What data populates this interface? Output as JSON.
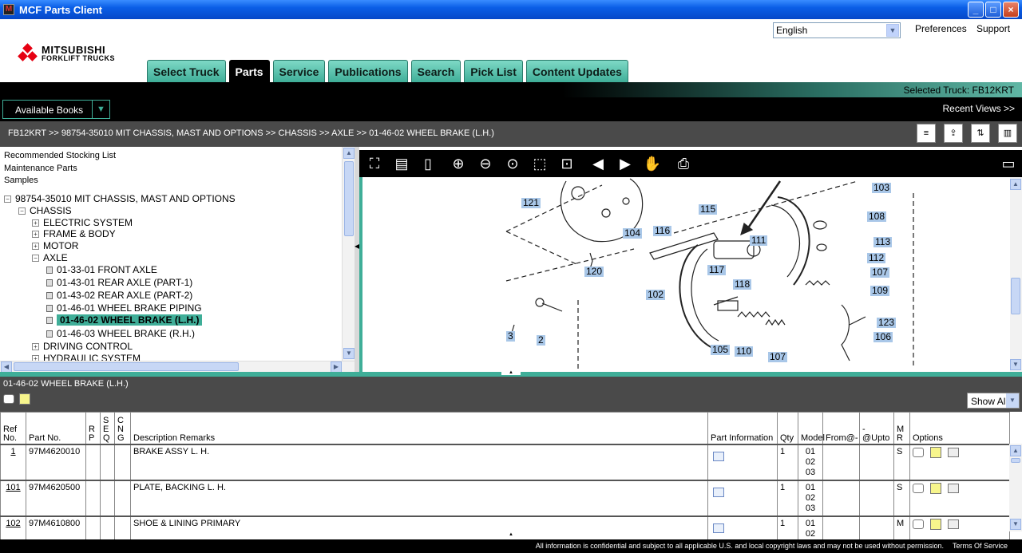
{
  "window": {
    "title": "MCF Parts Client"
  },
  "header": {
    "logo_line1": "MITSUBISHI",
    "logo_line2": "FORKLIFT TRUCKS",
    "language": "English",
    "links": [
      "Preferences",
      "Support"
    ],
    "tabs": [
      "Select Truck",
      "Parts",
      "Service",
      "Publications",
      "Search",
      "Pick List",
      "Content Updates"
    ],
    "active_tab": "Parts"
  },
  "selected_truck": "Selected Truck:  FB12KRT",
  "available_books": "Available Books",
  "recent_views": "Recent Views >>",
  "breadcrumb": "FB12KRT >> 98754-35010 MIT CHASSIS, MAST AND OPTIONS >> CHASSIS >> AXLE >> 01-46-02 WHEEL BRAKE (L.H.)",
  "tree": {
    "top_links": [
      "Recommended Stocking List",
      "Maintenance Parts",
      "Samples"
    ],
    "root": "98754-35010 MIT CHASSIS, MAST AND OPTIONS",
    "chassis": "CHASSIS",
    "groups": [
      "ELECTRIC SYSTEM",
      "FRAME & BODY",
      "MOTOR",
      "AXLE"
    ],
    "axle_items": [
      "01-33-01 FRONT AXLE",
      "01-43-01 REAR AXLE (PART-1)",
      "01-43-02 REAR AXLE (PART-2)",
      "01-46-01 WHEEL BRAKE PIPING",
      "01-46-02 WHEEL BRAKE (L.H.)",
      "01-46-03 WHEEL BRAKE (R.H.)"
    ],
    "more_groups": [
      "DRIVING CONTROL",
      "HYDRAULIC SYSTEM"
    ]
  },
  "diagram_labels": [
    "121",
    "115",
    "116",
    "104",
    "111",
    "103",
    "108",
    "113",
    "112",
    "120",
    "117",
    "118",
    "102",
    "107",
    "109",
    "123",
    "106",
    "3",
    "2",
    "105",
    "110",
    "107"
  ],
  "parts_panel": {
    "title": "01-46-02 WHEEL BRAKE (L.H.)",
    "filter": "Show All",
    "columns": {
      "ref": "Ref No.",
      "part": "Part No.",
      "rp": "R P",
      "seq": "S E Q",
      "cng": "C N G",
      "desc": "Description Remarks",
      "pinfo": "Part Information",
      "qty": "Qty",
      "model": "Model",
      "from": "From@-",
      "upto": "-@Upto",
      "mr": "M R",
      "options": "Options"
    },
    "rows": [
      {
        "ref": "1",
        "part": "97M4620010",
        "desc": "BRAKE ASSY L. H.",
        "qty": "1",
        "models": [
          "01",
          "02",
          "03"
        ],
        "mr": "S"
      },
      {
        "ref": "101",
        "part": "97M4620500",
        "desc": "PLATE, BACKING L. H.",
        "qty": "1",
        "models": [
          "01",
          "02",
          "03"
        ],
        "mr": "S"
      },
      {
        "ref": "102",
        "part": "97M4610800",
        "desc": "SHOE & LINING PRIMARY",
        "qty": "1",
        "models": [
          "01",
          "02"
        ],
        "mr": "M"
      }
    ]
  },
  "footer": {
    "notice": "All information is confidential and subject to all applicable U.S. and local copyright laws and may not be used without permission.",
    "terms": "Terms Of Service"
  }
}
